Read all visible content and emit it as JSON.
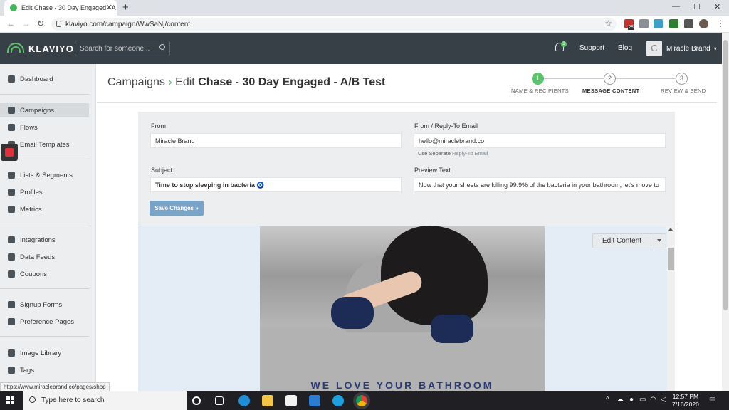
{
  "browser": {
    "tab_title": "Edit Chase - 30 Day Engaged - A",
    "new_tab": "+",
    "url": "klaviyo.com/campaign/WwSaNj/content",
    "win_min": "—",
    "win_max": "☐",
    "win_close": "✕",
    "ext_badge": "25",
    "status_url": "https://www.miraclebrand.co/pages/shop"
  },
  "topnav": {
    "brand": "KLAVIYO",
    "search_placeholder": "Search for someone...",
    "notif_count": "3",
    "support": "Support",
    "blog": "Blog",
    "avatar_letter": "C",
    "account": "Miracle Brand",
    "account_caret": "▾"
  },
  "sidebar": {
    "items": [
      {
        "label": "Dashboard"
      },
      {
        "label": "Campaigns"
      },
      {
        "label": "Flows"
      },
      {
        "label": "Email Templates"
      },
      {
        "label": "Lists & Segments"
      },
      {
        "label": "Profiles"
      },
      {
        "label": "Metrics"
      },
      {
        "label": "Integrations"
      },
      {
        "label": "Data Feeds"
      },
      {
        "label": "Coupons"
      },
      {
        "label": "Signup Forms"
      },
      {
        "label": "Preference Pages"
      },
      {
        "label": "Image Library"
      },
      {
        "label": "Tags"
      }
    ],
    "active": "Campaigns"
  },
  "header": {
    "crumb_root": "Campaigns",
    "crumb_sep": "›",
    "edit_prefix": "Edit",
    "campaign_name": "Chase - 30 Day Engaged - A/B Test"
  },
  "steps": [
    {
      "num": "1",
      "label": "NAME & RECIPIENTS",
      "state": "done"
    },
    {
      "num": "2",
      "label": "MESSAGE CONTENT",
      "state": "current"
    },
    {
      "num": "3",
      "label": "REVIEW & SEND",
      "state": "todo"
    }
  ],
  "form": {
    "from_label": "From",
    "from_value": "Miracle Brand",
    "reply_label": "From / Reply-To Email",
    "reply_value": "hello@miraclebrand.co",
    "hint_prefix": "Use Separate",
    "hint_link": "Reply-To Email",
    "subject_label": "Subject",
    "subject_value": "Time to stop sleeping in bacteria 🧿",
    "preview_label": "Preview Text",
    "preview_value": "Now that your sheets are killing 99.9% of the bacteria in your bathroom, let's move to",
    "save_button": "Save Changes »"
  },
  "preview": {
    "edit_content": "Edit Content",
    "banner_text": "WE LOVE YOUR BATHROOM"
  },
  "taskbar": {
    "search_placeholder": "Type here to search",
    "time": "12:57 PM",
    "date": "7/16/2020"
  },
  "colors": {
    "brand_green": "#5ac26b",
    "nav_bg": "#373f47",
    "save_button": "#7aa4c7",
    "preview_bg": "#e4ecf5"
  }
}
